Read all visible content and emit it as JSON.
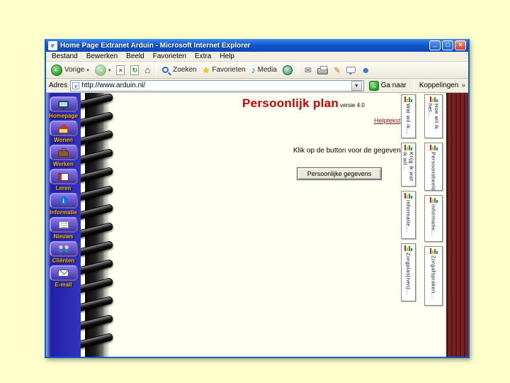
{
  "colors": {
    "desktop_bg": "#FFFFCC",
    "titlebar_blue": "#1458CE",
    "page_title_red": "#CC0000",
    "sidebar_blue": "#2A2AB4",
    "sidebar_label_gold": "#FFB900",
    "cover_maroon": "#7A1F1F"
  },
  "window": {
    "title": "Home Page Extranet Arduin - Microsoft Internet Explorer"
  },
  "menubar": {
    "items": [
      "Bestand",
      "Bewerken",
      "Beeld",
      "Favorieten",
      "Extra",
      "Help"
    ]
  },
  "toolbar": {
    "back": "Vorige",
    "search": "Zoeken",
    "favorites": "Favorieten",
    "media": "Media"
  },
  "addressbar": {
    "label": "Adres",
    "url": "http://www.arduin.nl/",
    "go": "Ga naar",
    "links_label": "Koppelingen",
    "links_chevron": "»"
  },
  "sidebar": {
    "items": [
      {
        "label": "Homepage",
        "icon": "computer-icon"
      },
      {
        "label": "Wonen",
        "icon": "house-icon"
      },
      {
        "label": "Werken",
        "icon": "briefcase-icon"
      },
      {
        "label": "Leren",
        "icon": "book-icon"
      },
      {
        "label": "Informatie",
        "icon": "info-icon"
      },
      {
        "label": "Nieuws",
        "icon": "newspaper-icon"
      },
      {
        "label": "Cliënten",
        "icon": "people-icon"
      },
      {
        "label": "E-mail",
        "icon": "envelope-icon"
      }
    ]
  },
  "page": {
    "title": "Persoonlijk plan",
    "version": "versie 4.0",
    "help_link": "Helptekst",
    "instruction": "Klik op de button voor de gegevens!",
    "button_label": "Persoonlijke gegevens"
  },
  "tabs": {
    "col1": [
      {
        "label": "Wat wil ik..."
      },
      {
        "label": "Krijg ik wat ik wil..."
      },
      {
        "label": "Informatie..."
      },
      {
        "label": "Zorgplan(nen)..."
      }
    ],
    "col2": [
      {
        "label": "Hoe wil ik het..."
      },
      {
        "label": "Persoonsbeeld..."
      },
      {
        "label": "Informatie..."
      },
      {
        "label": "Zorgafspraken..."
      }
    ]
  }
}
